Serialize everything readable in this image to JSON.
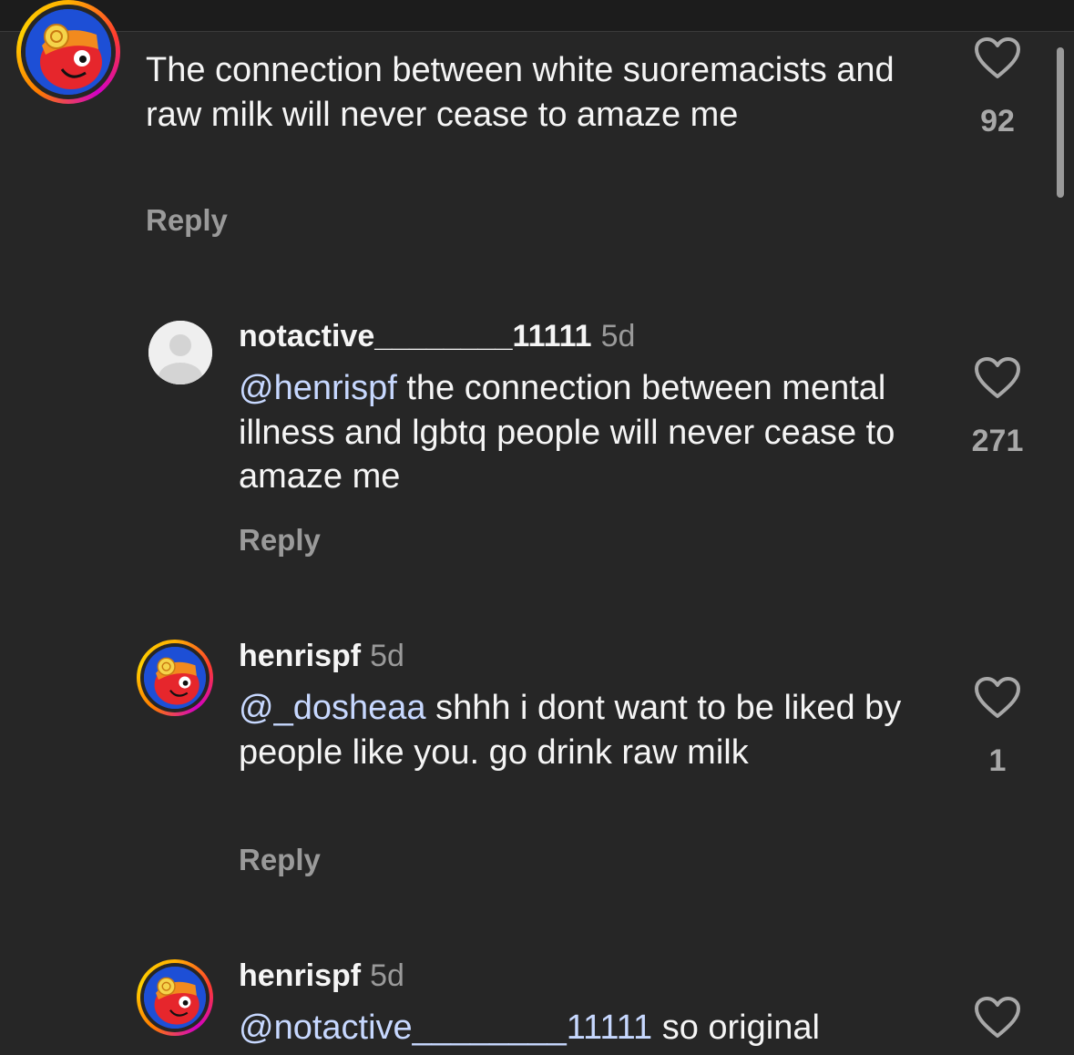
{
  "comments": [
    {
      "username": "",
      "age": "",
      "text_parts": [
        {
          "mention": "",
          "text": "The connection between white suoremacists and raw milk will never cease to amaze me"
        }
      ],
      "reply_label": "Reply",
      "like_count": "92"
    },
    {
      "username": "notactive________11111",
      "age": "5d",
      "text_parts": [
        {
          "mention": "@henrispf",
          "text": " the connection between mental illness and lgbtq people will never cease to amaze me"
        }
      ],
      "reply_label": "Reply",
      "like_count": "271"
    },
    {
      "username": "henrispf",
      "age": "5d",
      "text_parts": [
        {
          "mention": "@_dosheaa",
          "text": " shhh i dont want to be liked by people like you. go drink raw milk"
        }
      ],
      "reply_label": "Reply",
      "like_count": "1"
    },
    {
      "username": "henrispf",
      "age": "5d",
      "text_parts": [
        {
          "mention": "@notactive________11111",
          "text": " so original"
        }
      ],
      "reply_label": "",
      "like_count": ""
    }
  ],
  "colors": {
    "background": "#262626",
    "text": "#f5f5f5",
    "muted": "#9a9a9a",
    "mention": "#c7d8ff"
  }
}
